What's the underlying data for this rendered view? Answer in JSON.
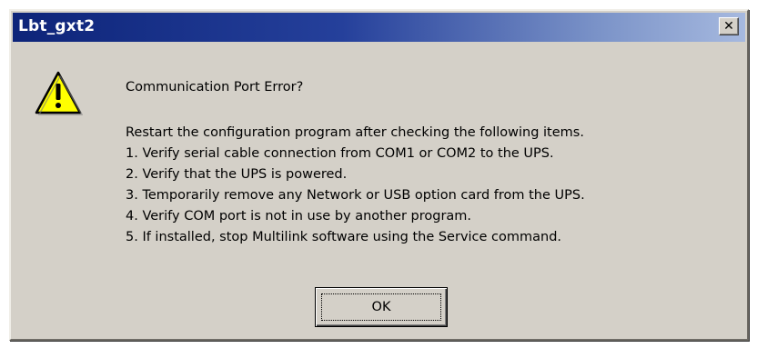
{
  "window": {
    "title": "Lbt_gxt2",
    "close_glyph": "✕"
  },
  "icon": {
    "name": "warning-icon",
    "symbol": "!",
    "fill_color": "#ffff00"
  },
  "message": {
    "heading": "Communication Port Error?",
    "lines": [
      "Restart the configuration program after checking the following items.",
      "1. Verify serial cable connection from COM1 or COM2 to the UPS.",
      "2. Verify that the UPS is powered.",
      "3. Temporarily remove any Network or USB option card from the UPS.",
      "4. Verify COM port is not in use by another program.",
      "5. If installed, stop Multilink software using the Service command."
    ]
  },
  "buttons": {
    "ok_label": "OK"
  },
  "colors": {
    "titlebar_start": "#0d2479",
    "titlebar_end": "#a6b9df",
    "dialog_face": "#d4d0c8"
  }
}
